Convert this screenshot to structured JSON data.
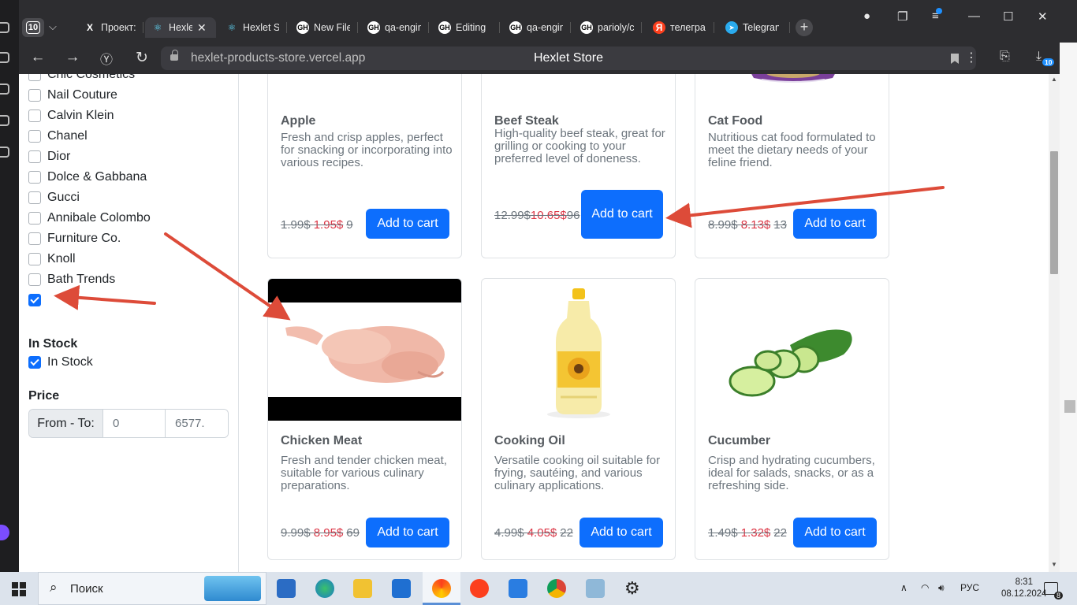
{
  "browser": {
    "tab_count": "10",
    "tabs": [
      {
        "label": "Проект:",
        "favicon": "X"
      },
      {
        "label": "Hexlet",
        "favicon": "⚛"
      },
      {
        "label": "Hexlet S",
        "favicon": "⚛"
      },
      {
        "label": "New File",
        "favicon": "GH"
      },
      {
        "label": "qa-engin",
        "favicon": "GH"
      },
      {
        "label": "Editing",
        "favicon": "GH"
      },
      {
        "label": "qa-engin",
        "favicon": "GH"
      },
      {
        "label": "pariolу/c",
        "favicon": "GH"
      },
      {
        "label": "телегра",
        "favicon": "Я"
      },
      {
        "label": "Telegran",
        "favicon": "➤"
      }
    ],
    "url": "hexlet-products-store.vercel.app",
    "page_title": "Hexlet Store",
    "downloads_badge": "10"
  },
  "sidebar": {
    "brands": [
      {
        "label": "Chic Cosmetics",
        "checked": false
      },
      {
        "label": "Nail Couture",
        "checked": false
      },
      {
        "label": "Calvin Klein",
        "checked": false
      },
      {
        "label": "Chanel",
        "checked": false
      },
      {
        "label": "Dior",
        "checked": false
      },
      {
        "label": "Dolce & Gabbana",
        "checked": false
      },
      {
        "label": "Gucci",
        "checked": false
      },
      {
        "label": "Annibale Colombo",
        "checked": false
      },
      {
        "label": "Furniture Co.",
        "checked": false
      },
      {
        "label": "Knoll",
        "checked": false
      },
      {
        "label": "Bath Trends",
        "checked": false
      },
      {
        "label": "",
        "checked": true
      }
    ],
    "in_stock_title": "In Stock",
    "in_stock_label": "In Stock",
    "price_title": "Price",
    "price_addon": "From - To:",
    "price_from": "0",
    "price_to": "6577."
  },
  "products": [
    {
      "name": "Apple",
      "description": "Fresh and crisp apples, perfect for snacking or incorporating into various recipes.",
      "old_price": "1.99$",
      "new_price": "1.95$",
      "stock": "9",
      "button": "Add to cart"
    },
    {
      "name": "Beef Steak",
      "description": "High-quality beef steak, great for grilling or cooking to your preferred level of doneness.",
      "old_price": "12.99$",
      "new_price": "10.65$",
      "stock": "96",
      "button": "Add to cart"
    },
    {
      "name": "Cat Food",
      "description": "Nutritious cat food formulated to meet the dietary needs of your feline friend.",
      "old_price": "8.99$",
      "new_price": "8.13$",
      "stock": "13",
      "button": "Add to cart"
    },
    {
      "name": "Chicken Meat",
      "description": "Fresh and tender chicken meat, suitable for various culinary preparations.",
      "old_price": "9.99$",
      "new_price": "8.95$",
      "stock": "69",
      "button": "Add to cart"
    },
    {
      "name": "Cooking Oil",
      "description": "Versatile cooking oil suitable for frying, sautéing, and various culinary applications.",
      "old_price": "4.99$",
      "new_price": "4.05$",
      "stock": "22",
      "button": "Add to cart"
    },
    {
      "name": "Cucumber",
      "description": "Crisp and hydrating cucumbers, ideal for salads, snacks, or as a refreshing side.",
      "old_price": "1.49$",
      "new_price": "1.32$",
      "stock": "22",
      "button": "Add to cart"
    }
  ],
  "annotation_color": "#dd4b39",
  "taskbar": {
    "search_placeholder": "Поиск",
    "language": "РУС",
    "time": "8:31",
    "date": "08.12.2024",
    "notifications": "8"
  }
}
